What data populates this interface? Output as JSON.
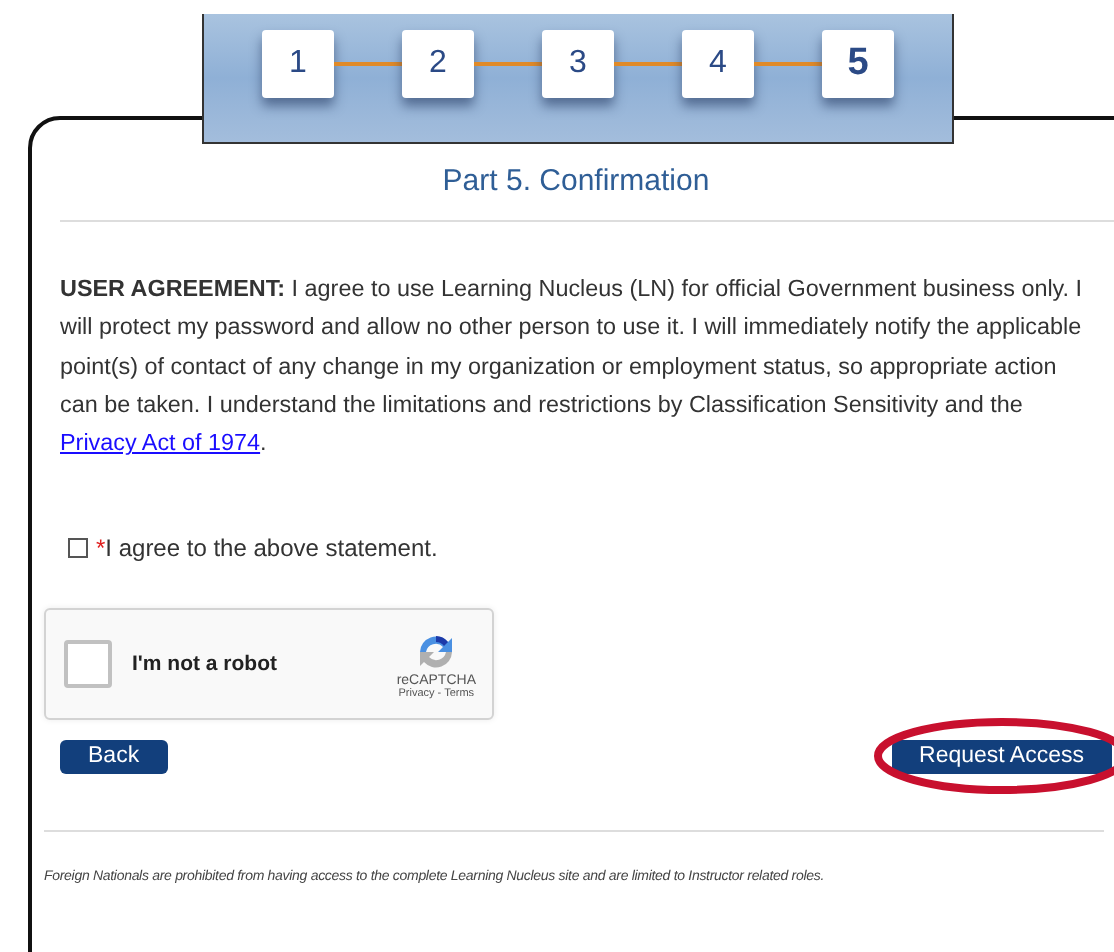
{
  "steps": [
    {
      "label": "1",
      "selected": false
    },
    {
      "label": "2",
      "selected": false
    },
    {
      "label": "3",
      "selected": false
    },
    {
      "label": "4",
      "selected": false
    },
    {
      "label": "5",
      "selected": true
    }
  ],
  "title": "Part 5. Confirmation",
  "agreement": {
    "text": "**USER AGREEMENT:** I agree to use Learning Nucleus (LN) for official Government business only. I will protect my password and allow no other person to use it. I will immediately notify the applicable point(s) of contact of any change in my organization or employment status, so appropriate action can be taken. I understand the limitations and restrictions by Classification Sensitivity and the ",
    "link": "Privacy Act of 1974",
    "after": "."
  },
  "consent": {
    "required_mark": "*",
    "label": "I agree to the above statement.",
    "checked": false
  },
  "captcha": {
    "label": "I'm not a robot",
    "checked": false,
    "brand": "reCAPTCHA",
    "links": "Privacy - Terms"
  },
  "buttons": [
    {
      "label": "Back",
      "highlighted": false
    },
    {
      "label": "Request Access",
      "highlighted": true
    }
  ],
  "footer": "Foreign Nationals are prohibited from having access to the complete Learning Nucleus site and are limited to Instructor related roles."
}
